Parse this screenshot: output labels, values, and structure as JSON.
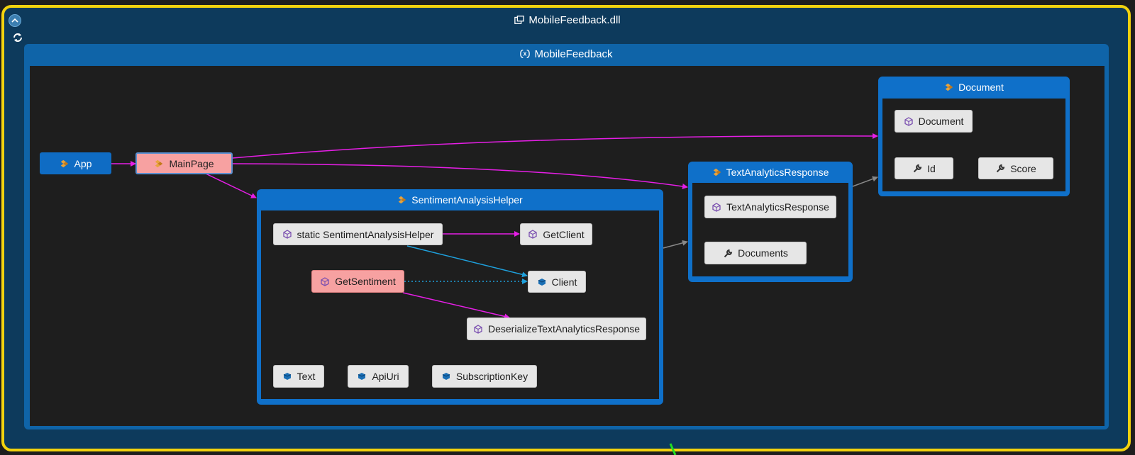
{
  "assembly": {
    "title": "MobileFeedback.dll"
  },
  "namespace": {
    "title": "MobileFeedback"
  },
  "nodes": {
    "app": "App",
    "main_page": "MainPage"
  },
  "groups": {
    "sentiment": {
      "title": "SentimentAnalysisHelper",
      "members": {
        "static_ctor": "static SentimentAnalysisHelper",
        "get_client": "GetClient",
        "get_sentiment": "GetSentiment",
        "client": "Client",
        "deserialize": "DeserializeTextAnalyticsResponse",
        "text": "Text",
        "api_uri": "ApiUri",
        "subscription_key": "SubscriptionKey"
      }
    },
    "text_analytics": {
      "title": "TextAnalyticsResponse",
      "members": {
        "ctor": "TextAnalyticsResponse",
        "documents": "Documents"
      }
    },
    "document": {
      "title": "Document",
      "members": {
        "ctor": "Document",
        "id": "Id",
        "score": "Score"
      }
    }
  },
  "colors": {
    "frame_highlight": "#f2d20e",
    "group_blue": "#0f70c9",
    "edge_call": "#e61ee6",
    "edge_field": "#1ea0dc",
    "edge_dependency": "#888888",
    "node_highlight": "#f7a1a1"
  }
}
